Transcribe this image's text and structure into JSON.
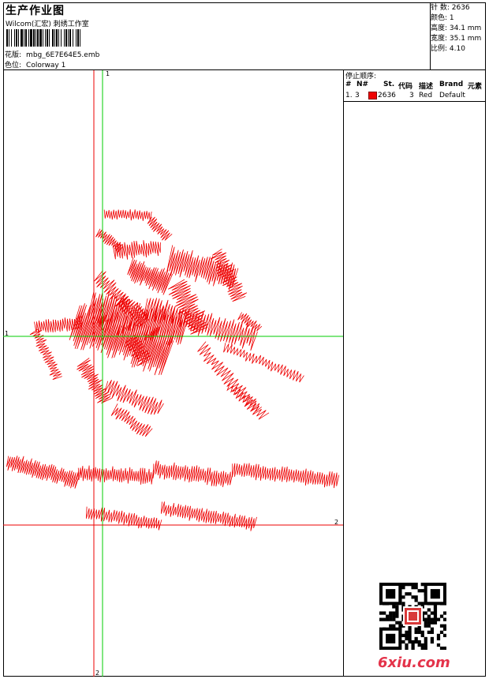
{
  "header": {
    "title": "生产作业图",
    "subtitle": "Wilcom(汇宏) 刺绣工作室",
    "filename_label": "花版:",
    "filename_value": "mbg_6E7E64E5.emb",
    "colorway_label": "色位:",
    "colorway_value": "Colorway 1"
  },
  "stats": {
    "stitches": "针 数: 2636",
    "colors": "颜色: 1",
    "height": "高度: 34.1 mm",
    "width": "宽度: 35.1 mm",
    "scale": "比例: 4.10"
  },
  "stop_sequence": {
    "title": "停止顺序:",
    "columns": [
      "#",
      "N#",
      "St.",
      "代码",
      "描述",
      "Brand",
      "元素"
    ],
    "rows": [
      {
        "index": "1.",
        "needle": "3",
        "stitches": "2636",
        "code": "3",
        "description": "Red",
        "brand": "Default",
        "element": ""
      }
    ]
  },
  "guides": {
    "label_v1": "1",
    "label_h1": "1",
    "label_h2": "2",
    "label_v2": "2"
  },
  "colors": {
    "thread": "#ee0000",
    "guide_green": "#00cc00",
    "guide_red": "#ee0000",
    "brand": "#e4334a"
  },
  "brand": {
    "text": "6xiu.com"
  }
}
